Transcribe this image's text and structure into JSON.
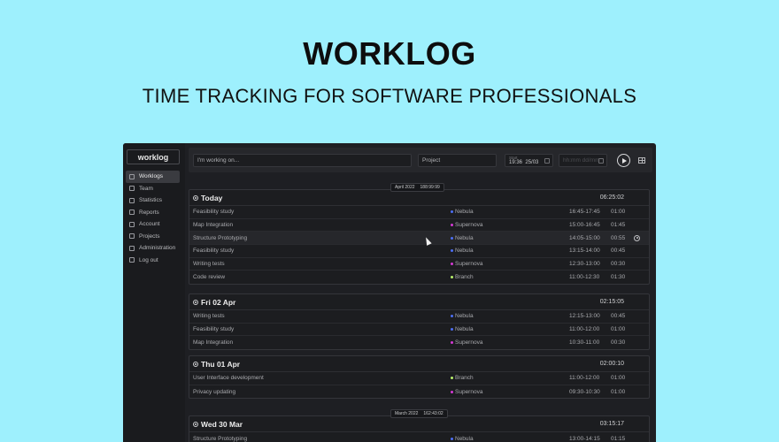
{
  "hero": {
    "title": "WORKLOG",
    "subtitle": "TIME TRACKING FOR SOFTWARE PROFESSIONALS"
  },
  "sidebar": {
    "logo": "worklog",
    "items": [
      {
        "label": "Worklogs",
        "icon": "worklogs-icon",
        "active": true
      },
      {
        "label": "Team",
        "icon": "team-icon"
      },
      {
        "label": "Statistics",
        "icon": "statistics-icon"
      },
      {
        "label": "Reports",
        "icon": "reports-icon"
      },
      {
        "label": "Account",
        "icon": "account-icon"
      },
      {
        "label": "Projects",
        "icon": "projects-icon"
      },
      {
        "label": "Administration",
        "icon": "administration-icon"
      },
      {
        "label": "Log out",
        "icon": "logout-icon"
      }
    ]
  },
  "toolbar": {
    "task_placeholder": "I'm working on...",
    "project_placeholder": "Project",
    "start_label": "Start",
    "start_time": "19:36",
    "start_date": "25/03",
    "end_placeholder": "hh:mm dd/mm"
  },
  "month_tags": [
    {
      "month": "April 2022",
      "total": "188:99:99"
    },
    {
      "month": "March 2022",
      "total": "162:43:02"
    }
  ],
  "projects": {
    "Nebula": "#4c6ef5",
    "Supernova": "#d63ad6",
    "Branch": "#b8f06a"
  },
  "days": [
    {
      "title": "Today",
      "total": "06:25:02",
      "entries": [
        {
          "task": "Feasibility study",
          "project": "Nebula",
          "range": "16:45-17:45",
          "duration": "01:00"
        },
        {
          "task": "Map Integration",
          "project": "Supernova",
          "range": "15:00-16:45",
          "duration": "01:45"
        },
        {
          "task": "Structure Prototyping",
          "project": "Nebula",
          "range": "14:05-15:00",
          "duration": "00:55"
        },
        {
          "task": "Feasibility study",
          "project": "Nebula",
          "range": "13:15-14:00",
          "duration": "00:45"
        },
        {
          "task": "Writing tests",
          "project": "Supernova",
          "range": "12:30-13:00",
          "duration": "00:30"
        },
        {
          "task": "Code review",
          "project": "Branch",
          "range": "11:00-12:30",
          "duration": "01:30"
        }
      ]
    },
    {
      "title": "Fri 02  Apr",
      "total": "02:15:05",
      "entries": [
        {
          "task": "Writing tests",
          "project": "Nebula",
          "range": "12:15-13:00",
          "duration": "00:45"
        },
        {
          "task": "Feasibility study",
          "project": "Nebula",
          "range": "11:00-12:00",
          "duration": "01:00"
        },
        {
          "task": "Map Integration",
          "project": "Supernova",
          "range": "10:30-11:00",
          "duration": "00:30"
        }
      ]
    },
    {
      "title": "Thu 01  Apr",
      "total": "02:00:10",
      "entries": [
        {
          "task": "User Interface development",
          "project": "Branch",
          "range": "11:00-12:00",
          "duration": "01:00"
        },
        {
          "task": "Privacy updating",
          "project": "Supernova",
          "range": "09:30-10:30",
          "duration": "01:00"
        }
      ]
    },
    {
      "title": "Wed 30  Mar",
      "total": "03:15:17",
      "entries": [
        {
          "task": "Structure Prototyping",
          "project": "Nebula",
          "range": "13:00-14:15",
          "duration": "01:15"
        }
      ]
    }
  ]
}
